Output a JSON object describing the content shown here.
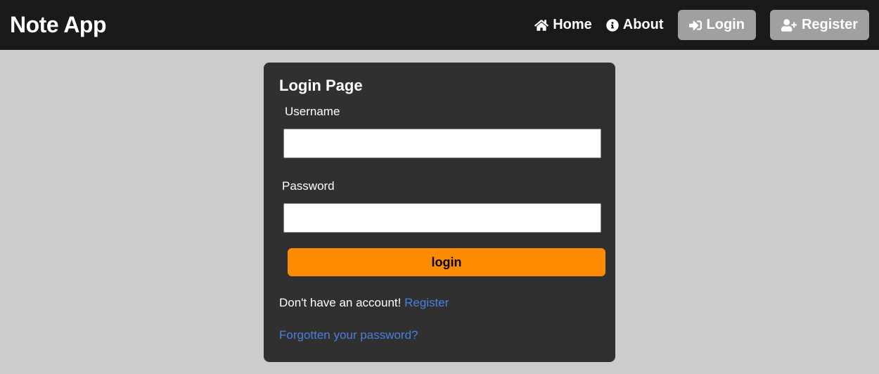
{
  "brand": "Note App",
  "nav": {
    "home": "Home",
    "about": "About",
    "login": "Login",
    "register": "Register"
  },
  "card": {
    "title": "Login Page",
    "username_label": "Username",
    "password_label": "Password",
    "login_button": "login",
    "no_account_text": "Don't have an account! ",
    "register_link": "Register",
    "forgot_link": "Forgotten your password?"
  }
}
